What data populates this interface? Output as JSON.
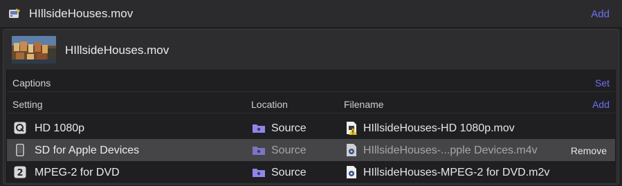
{
  "header": {
    "title": "HIllsideHouses.mov",
    "add_label": "Add"
  },
  "source": {
    "filename": "HIllsideHouses.mov"
  },
  "captions": {
    "label": "Captions",
    "set_label": "Set"
  },
  "columns": {
    "setting": "Setting",
    "location": "Location",
    "filename": "Filename",
    "add_label": "Add"
  },
  "outputs": [
    {
      "setting": "HD 1080p",
      "location": "Source",
      "filename": "HIllsideHouses-HD 1080p.mov",
      "icon": "compressor-q-icon"
    },
    {
      "setting": "SD for Apple Devices",
      "location": "Source",
      "filename": "HIllsideHouses-...pple Devices.m4v",
      "icon": "iphone-icon",
      "action": "Remove"
    },
    {
      "setting": "MPEG-2 for DVD",
      "location": "Source",
      "filename": "HIllsideHouses-MPEG-2 for DVD.m2v",
      "icon": "mpeg2-icon"
    }
  ],
  "colors": {
    "accent": "#6f6ff5",
    "folder": "#8f86e8",
    "selected_row": "#454547"
  }
}
